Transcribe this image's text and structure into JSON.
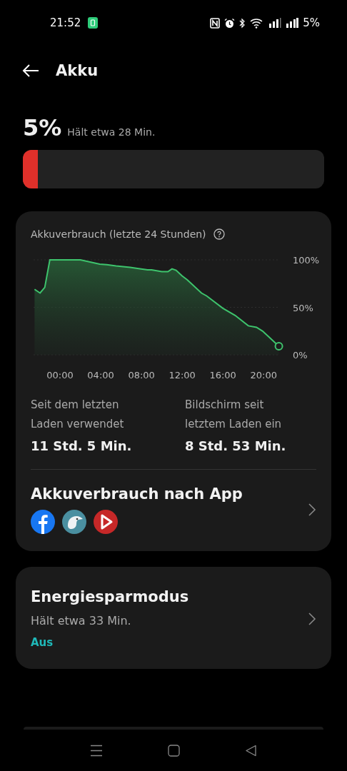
{
  "status_bar": {
    "time": "21:52",
    "battery": "5%"
  },
  "header": {
    "title": "Akku"
  },
  "summary": {
    "percent": "5%",
    "estimate": "Hält etwa 28 Min.",
    "level": 0.05
  },
  "usage_card": {
    "chart_data": {
      "type": "area",
      "title": "Akkuverbrauch (letzte 24 Stunden)",
      "x": [
        -2.5,
        -1.96,
        -1.5,
        -1.0,
        2.0,
        3.9,
        4.6,
        5.5,
        6.9,
        7.6,
        8.6,
        9.0,
        10.0,
        10.6,
        11.0,
        11.4,
        12.0,
        12.5,
        13.9,
        14.4,
        16.0,
        17.2,
        18.5,
        19.3,
        19.9,
        21.5
      ],
      "series": [
        {
          "color": "#3ec46d",
          "values": [
            69,
            65,
            71,
            100,
            100,
            95.5,
            95,
            93.5,
            92,
            91,
            89.5,
            89.5,
            87.5,
            87.5,
            90.5,
            89,
            83,
            79,
            65,
            62,
            49,
            41.5,
            30.5,
            29,
            25,
            9
          ]
        }
      ],
      "xlim": [
        -2.6,
        21.6
      ],
      "ylim": [
        0,
        100
      ],
      "xticks": [
        {
          "value": 0,
          "label": "00:00"
        },
        {
          "value": 4,
          "label": "04:00"
        },
        {
          "value": 8,
          "label": "08:00"
        },
        {
          "value": 12,
          "label": "12:00"
        },
        {
          "value": 16,
          "label": "16:00"
        },
        {
          "value": 20,
          "label": "20:00"
        }
      ],
      "yticks": [
        {
          "value": 100,
          "label": "100%"
        },
        {
          "value": 50,
          "label": "50%"
        },
        {
          "value": 0,
          "label": "0%"
        }
      ]
    },
    "stats": [
      {
        "label": "Seit dem letzten Laden verwendet",
        "value": "11 Std. 5 Min."
      },
      {
        "label": "Bildschirm seit letztem Laden ein",
        "value": "8 Std. 53 Min."
      }
    ],
    "app_usage": {
      "title": "Akkuverbrauch nach App"
    }
  },
  "saver": {
    "title": "Energiesparmodus",
    "estimate": "Hält etwa 33 Min.",
    "status": "Aus",
    "on": false
  }
}
